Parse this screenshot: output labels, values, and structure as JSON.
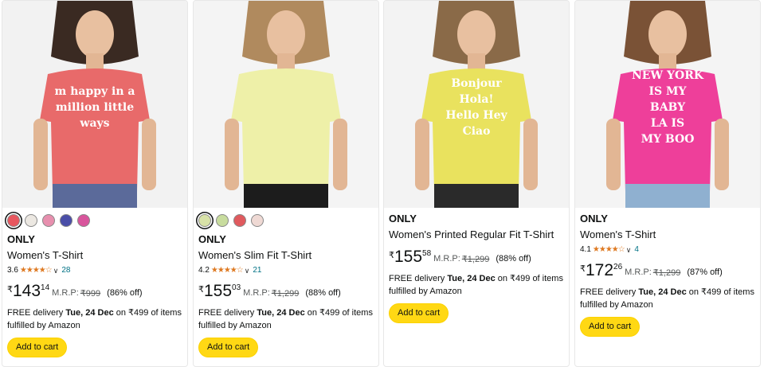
{
  "products": [
    {
      "brand": "ONLY",
      "title": "Women's T-Shirt",
      "rating": "3.6",
      "stars": "★★★★☆",
      "rating_count": "28",
      "currency": "₹",
      "price_whole": "143",
      "price_fraction": "14",
      "mrp_label": "M.R.P:",
      "mrp": "₹999",
      "discount": "(86% off)",
      "delivery_pre": "FREE delivery ",
      "delivery_date": "Tue, 24 Dec",
      "delivery_post": " on ₹499 of items fulfilled by Amazon",
      "add_to_cart": "Add to cart",
      "swatches": [
        "#e7575f",
        "#ece8e2",
        "#e78fae",
        "#4a4ea8",
        "#d8559c"
      ],
      "shirt_color": "#e86a6a",
      "shirt_text": [
        "m happy in a",
        "million little",
        "ways"
      ],
      "shirt_text_color": "#ffffff",
      "bottom_color": "#5b6a9a",
      "hair_color": "#3a2a22",
      "bg_color": "#f2f2f2"
    },
    {
      "brand": "ONLY",
      "title": "Women's Slim Fit T-Shirt",
      "rating": "4.2",
      "stars": "★★★★☆",
      "rating_count": "21",
      "currency": "₹",
      "price_whole": "155",
      "price_fraction": "03",
      "mrp_label": "M.R.P:",
      "mrp": "₹1,299",
      "discount": "(88% off)",
      "delivery_pre": "FREE delivery ",
      "delivery_date": "Tue, 24 Dec",
      "delivery_post": " on ₹499 of items fulfilled by Amazon",
      "add_to_cart": "Add to cart",
      "swatches": [
        "#d8e2a8",
        "#c8dc9e",
        "#e05a5e",
        "#efd9d4"
      ],
      "shirt_color": "#eef0a8",
      "shirt_text": [],
      "shirt_text_color": "#ffffff",
      "bottom_color": "#1c1c1c",
      "hair_color": "#b08a5e",
      "bg_color": "#f4f4f4"
    },
    {
      "brand": "ONLY",
      "title": "Women's Printed Regular Fit T-Shirt",
      "currency": "₹",
      "price_whole": "155",
      "price_fraction": "58",
      "mrp_label": "M.R.P:",
      "mrp": "₹1,299",
      "discount": "(88% off)",
      "delivery_pre": "FREE delivery ",
      "delivery_date": "Tue, 24 Dec",
      "delivery_post": " on ₹499 of items fulfilled by Amazon",
      "add_to_cart": "Add to cart",
      "shirt_color": "#e9e25e",
      "shirt_text": [
        "Bonjour",
        "Hola!",
        "Hello   Hey",
        "Ciao"
      ],
      "shirt_text_color": "#ffffff",
      "bottom_color": "#2a2a2a",
      "hair_color": "#8a6a48",
      "bg_color": "#f3f3f3"
    },
    {
      "brand": "ONLY",
      "title": "Women's T-Shirt",
      "rating": "4.1",
      "stars": "★★★★☆",
      "rating_count": "4",
      "currency": "₹",
      "price_whole": "172",
      "price_fraction": "26",
      "mrp_label": "M.R.P:",
      "mrp": "₹1,299",
      "discount": "(87% off)",
      "delivery_pre": "FREE delivery ",
      "delivery_date": "Tue, 24 Dec",
      "delivery_post": " on ₹499 of items fulfilled by Amazon",
      "add_to_cart": "Add to cart",
      "shirt_color": "#ee3f9a",
      "shirt_text": [
        "NEW YORK",
        "IS MY",
        "BABY",
        "LA   IS",
        "MY  BOO"
      ],
      "shirt_text_color": "#ffffff",
      "bottom_color": "#8fb0d0",
      "hair_color": "#7a5236",
      "bg_color": "#f4f4f4"
    }
  ]
}
